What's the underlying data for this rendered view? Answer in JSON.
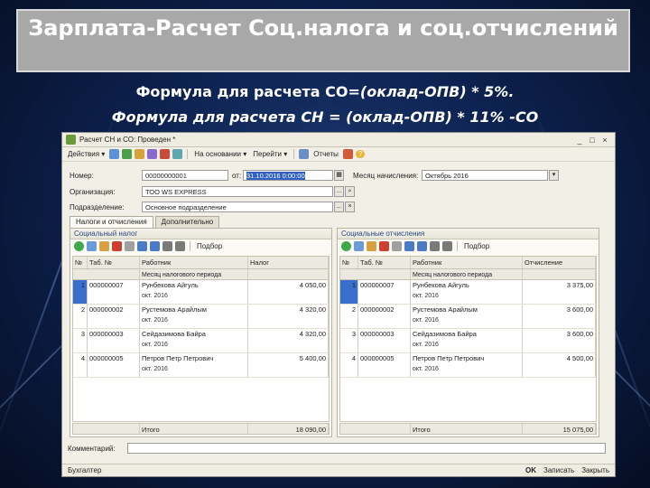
{
  "slide": {
    "title": "Зарплата-Расчет Соц.налога и соц.отчислений",
    "formula1_prefix": "Формула для расчета СО=",
    "formula1_italic": "(оклад-ОПВ) * 5%.",
    "formula2": "Формула для расчета СН = (оклад-ОПВ) * 11% -СО"
  },
  "window": {
    "title": "Расчет СН и СО: Проведен *",
    "controls": [
      "_",
      "□",
      "×"
    ],
    "toolbar": {
      "actions_label": "Действия ▾",
      "basis_label": "На основании ▾",
      "go_label": "Перейти ▾",
      "report_label": "Отчеты",
      "help_label": "?"
    },
    "header": {
      "number_label": "Номер:",
      "number_value": "00000000001",
      "from_label": "от:",
      "date_value": "31.10.2016 0:00:00",
      "month_label": "Месяц начисления:",
      "month_value": "Октябрь 2016",
      "org_label": "Организация:",
      "org_value": "ТОО WS EXPRESS",
      "dept_label": "Подразделение:",
      "dept_value": "Основное подразделение"
    },
    "tabs": [
      "Налоги и отчисления",
      "Дополнительно"
    ],
    "tax_panel": {
      "title": "Социальный налог",
      "pick_label": "Подбор",
      "columns": [
        "№",
        "Таб. №",
        "Работник",
        "Налог"
      ],
      "subheader": "Месяц налогового периода",
      "rows": [
        {
          "n": "1",
          "tab": "000000007",
          "name": "Рунбекова Айгуль",
          "month": "окт. 2016",
          "value": "4 050,00"
        },
        {
          "n": "2",
          "tab": "000000002",
          "name": "Рустемова Арайлым",
          "month": "окт. 2016",
          "value": "4 320,00"
        },
        {
          "n": "3",
          "tab": "000000003",
          "name": "Сейдазимова Байра",
          "month": "окт. 2016",
          "value": "4 320,00"
        },
        {
          "n": "4",
          "tab": "000000005",
          "name": "Петров Петр Петрович",
          "month": "окт. 2016",
          "value": "5 400,00"
        }
      ],
      "total_label": "Итого",
      "total_value": "18 090,00"
    },
    "contrib_panel": {
      "title": "Социальные отчисления",
      "pick_label": "Подбор",
      "columns": [
        "№",
        "Таб. №",
        "Работник",
        "Отчисление"
      ],
      "subheader": "Месяц налогового периода",
      "rows": [
        {
          "n": "1",
          "tab": "000000007",
          "name": "Рунбекова Айгуль",
          "month": "окт. 2016",
          "value": "3 375,00"
        },
        {
          "n": "2",
          "tab": "000000002",
          "name": "Рустемова Арайлым",
          "month": "окт. 2016",
          "value": "3 600,00"
        },
        {
          "n": "3",
          "tab": "000000003",
          "name": "Сейдазимова Байра",
          "month": "окт. 2016",
          "value": "3 600,00"
        },
        {
          "n": "4",
          "tab": "000000005",
          "name": "Петров Петр Петрович",
          "month": "окт. 2016",
          "value": "4 500,00"
        }
      ],
      "total_label": "Итого",
      "total_value": "15 075,00"
    },
    "comment_label": "Комментарий:",
    "comment_value": "",
    "status": {
      "author": "Бухгалтер",
      "ok": "OK",
      "save": "Записать",
      "close": "Закрыть"
    }
  }
}
